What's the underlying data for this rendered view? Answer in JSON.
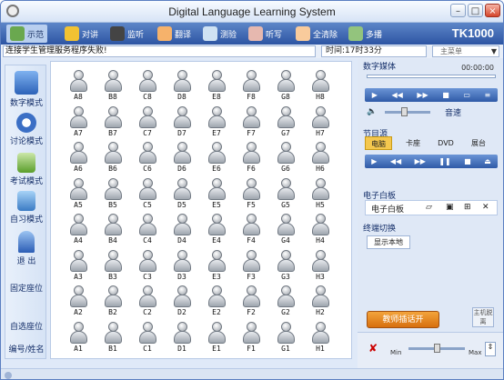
{
  "window": {
    "title": "Digital Language Learning System",
    "brand": "TK1000"
  },
  "toolbar": {
    "items": [
      {
        "label": "示范",
        "icon": "demo-icon"
      },
      {
        "label": "对讲",
        "icon": "intercom-icon"
      },
      {
        "label": "监听",
        "icon": "monitor-icon"
      },
      {
        "label": "翻译",
        "icon": "translate-icon"
      },
      {
        "label": "测验",
        "icon": "test-icon"
      },
      {
        "label": "听写",
        "icon": "dictation-icon"
      },
      {
        "label": "全清除",
        "icon": "clear-icon"
      },
      {
        "label": "多播",
        "icon": "multicast-icon"
      }
    ]
  },
  "status": {
    "message": "连接学生管理服务程序失败!",
    "time": "时间:17时33分",
    "select_value": "主菜单"
  },
  "leftnav": {
    "items": [
      {
        "label": "数字模式",
        "icon": "digital-mode-icon"
      },
      {
        "label": "讨论模式",
        "icon": "discussion-mode-icon"
      },
      {
        "label": "考试模式",
        "icon": "exam-mode-icon"
      },
      {
        "label": "自习模式",
        "icon": "self-study-icon"
      },
      {
        "label": "退  出",
        "icon": "exit-icon"
      }
    ],
    "bottom": [
      "固定座位",
      "自选座位",
      "编号/姓名"
    ]
  },
  "seats": {
    "columns": [
      "A",
      "B",
      "C",
      "D",
      "E",
      "F",
      "G",
      "H"
    ],
    "rows": [
      8,
      7,
      6,
      5,
      4,
      3,
      2,
      1
    ]
  },
  "right": {
    "media_title": "数字媒体",
    "media_time": "00:00:00",
    "volume_label": "音速",
    "program_title": "节目源",
    "sources": [
      "电脑",
      "卡座",
      "DVD",
      "展台"
    ],
    "selected_source": "电脑",
    "whiteboard_title": "电子白板",
    "whiteboard_label": "电子白板",
    "terminal_title": "终端切换",
    "terminal_button": "显示本地",
    "teacher_button": "教师插话开",
    "host_button": "主机脱离",
    "min_label": "Min",
    "max_label": "Max"
  }
}
